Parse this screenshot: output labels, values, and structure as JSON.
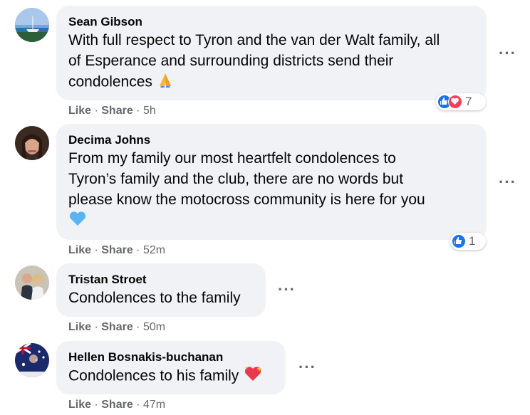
{
  "comments": [
    {
      "author": "Sean Gibson",
      "lines": [
        "With full respect to Tyron and the van der Walt family, all",
        "of Esperance and surrounding districts send their",
        "condolences"
      ],
      "emoji": "pray",
      "reaction_count": "7",
      "reactions": [
        "like",
        "love"
      ],
      "like": "Like",
      "share": "Share",
      "time": "5h"
    },
    {
      "author": "Decima Johns",
      "lines": [
        "From my family our most heartfelt condolences to",
        "Tyron’s family and the club, there are no words but",
        "please know the motocross community is here for you"
      ],
      "emoji": "blue-heart",
      "reaction_count": "1",
      "reactions": [
        "like"
      ],
      "like": "Like",
      "share": "Share",
      "time": "52m"
    },
    {
      "author": "Tristan Stroet",
      "lines": [
        "Condolences to the family"
      ],
      "like": "Like",
      "share": "Share",
      "time": "50m"
    },
    {
      "author": "Hellen Bosnakis-buchanan",
      "lines": [
        "Condolences to his family"
      ],
      "emoji": "sparkling-heart",
      "like": "Like",
      "share": "Share",
      "time": "47m"
    }
  ],
  "separator": "·",
  "more_glyph": "···",
  "colors": {
    "bubble": "#f0f2f5",
    "secondary_text": "#65676b",
    "like_blue": "#1b74e4",
    "love_red": "#f33e58"
  }
}
